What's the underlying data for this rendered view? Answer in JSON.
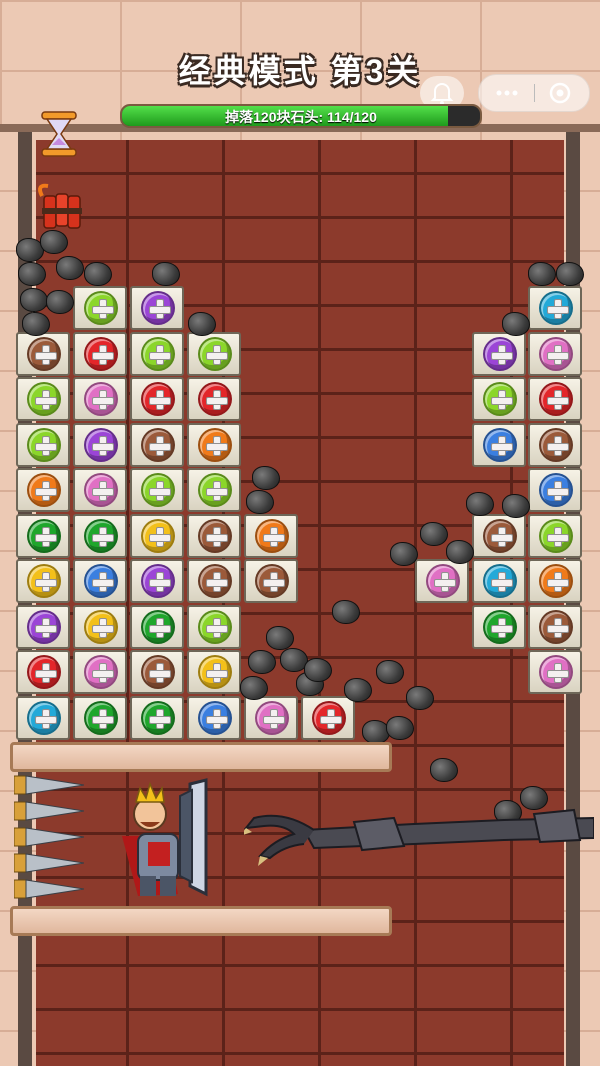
{
  "title": "经典模式 第3关",
  "progress": {
    "label": "掉落120块石头: 114/120",
    "current": 114,
    "total": 120
  },
  "icons": {
    "hourglass": "hourglass-icon",
    "bomb": "dynamite-icon",
    "bell": "bell-icon",
    "more": "more-dots-icon",
    "close": "mini-program-close-icon"
  },
  "screw_colors": {
    "brown": "#9b5a3a",
    "red": "#e3262a",
    "lime": "#8bd62a",
    "purple": "#9b45d6",
    "pink": "#e070c4",
    "orange": "#f07a1a",
    "green": "#1fa62c",
    "yellow": "#f3c01a",
    "blue": "#3b7fe0",
    "cyan": "#23a9d8"
  },
  "board": {
    "left_columns": [
      [
        "",
        "brown",
        "lime",
        "lime",
        "orange",
        "green",
        "yellow",
        "purple",
        "red",
        "cyan"
      ],
      [
        "lime",
        "red",
        "pink",
        "purple",
        "pink",
        "green",
        "blue",
        "yellow",
        "pink",
        "green"
      ],
      [
        "purple",
        "lime",
        "red",
        "brown",
        "lime",
        "yellow",
        "purple",
        "green",
        "brown",
        "green"
      ],
      [
        "",
        "lime",
        "red",
        "orange",
        "lime",
        "brown",
        "brown",
        "lime",
        "yellow",
        "blue"
      ],
      [
        "",
        "",
        "",
        "",
        "",
        "orange",
        "brown",
        "",
        "",
        "pink"
      ],
      [
        "",
        "",
        "",
        "",
        "",
        "",
        "",
        "",
        "",
        "red"
      ]
    ],
    "right_columns": [
      [
        "",
        "",
        "",
        "",
        "",
        "",
        "pink",
        "",
        "",
        ""
      ],
      [
        "",
        "purple",
        "lime",
        "blue",
        "",
        "brown",
        "cyan",
        "green",
        "",
        ""
      ],
      [
        "cyan",
        "pink",
        "red",
        "brown",
        "blue",
        "lime",
        "orange",
        "brown",
        "pink",
        ""
      ]
    ]
  }
}
